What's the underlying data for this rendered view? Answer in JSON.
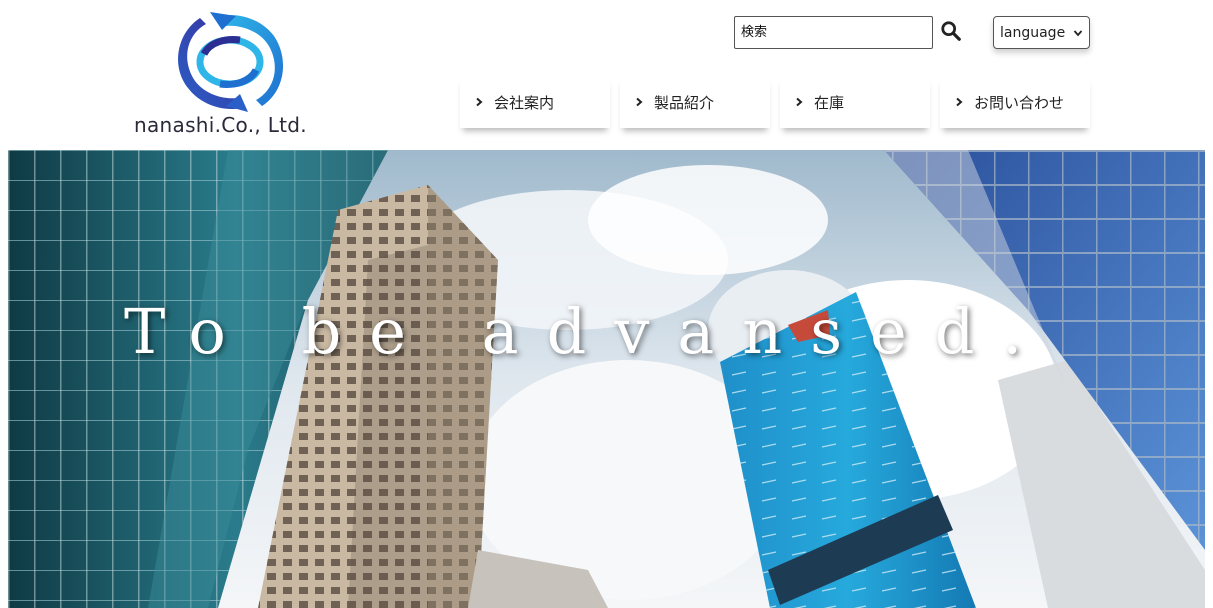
{
  "header": {
    "logo": {
      "text": "nanashi.Co., Ltd.",
      "colors": {
        "dark": "#2b2f94",
        "mid": "#1f6fd0",
        "light": "#2fb6e8"
      }
    },
    "search": {
      "placeholder": "検索",
      "button_icon": "search-icon"
    },
    "language": {
      "selected": "language",
      "icon": "chevron-down-icon"
    },
    "nav": [
      {
        "label": "会社案内",
        "icon": "chevron-right-icon"
      },
      {
        "label": "製品紹介",
        "icon": "chevron-right-icon"
      },
      {
        "label": "在庫",
        "icon": "chevron-right-icon"
      },
      {
        "label": "お問い合わせ",
        "icon": "chevron-right-icon"
      }
    ]
  },
  "hero": {
    "title": "To be advansed."
  }
}
